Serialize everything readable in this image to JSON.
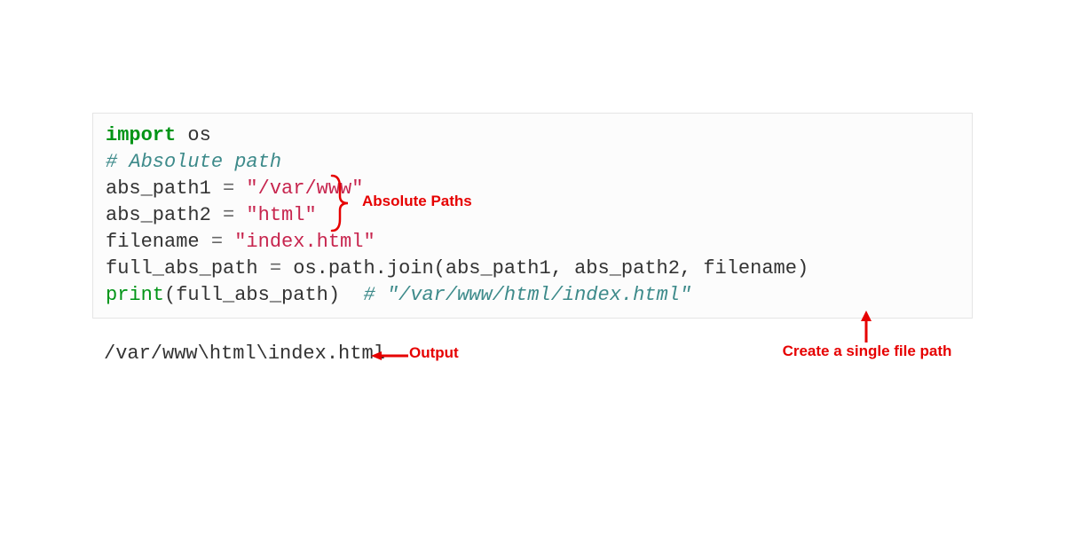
{
  "code": {
    "line1_import": "import",
    "line1_module": " os",
    "blank": "",
    "line3_comment": "# Absolute path",
    "line4_var": "abs_path1 ",
    "line4_eq": "=",
    "line4_str": " \"/var/www\"",
    "line5_var": "abs_path2 ",
    "line5_eq": "=",
    "line5_str": " \"html\"",
    "line6_var": "filename ",
    "line6_eq": "=",
    "line6_str": " \"index.html\"",
    "line7_var": "full_abs_path ",
    "line7_eq": "=",
    "line7_rest": " os.path.join(abs_path1, abs_path2, filename)",
    "line8_print": "print",
    "line8_args": "(full_abs_path)  ",
    "line8_comment": "# \"/var/www/html/index.html\""
  },
  "output": "/var/www\\html\\index.html",
  "annotations": {
    "absolute_paths": "Absolute Paths",
    "output_label": "Output",
    "single_file": "Create a single file path"
  }
}
